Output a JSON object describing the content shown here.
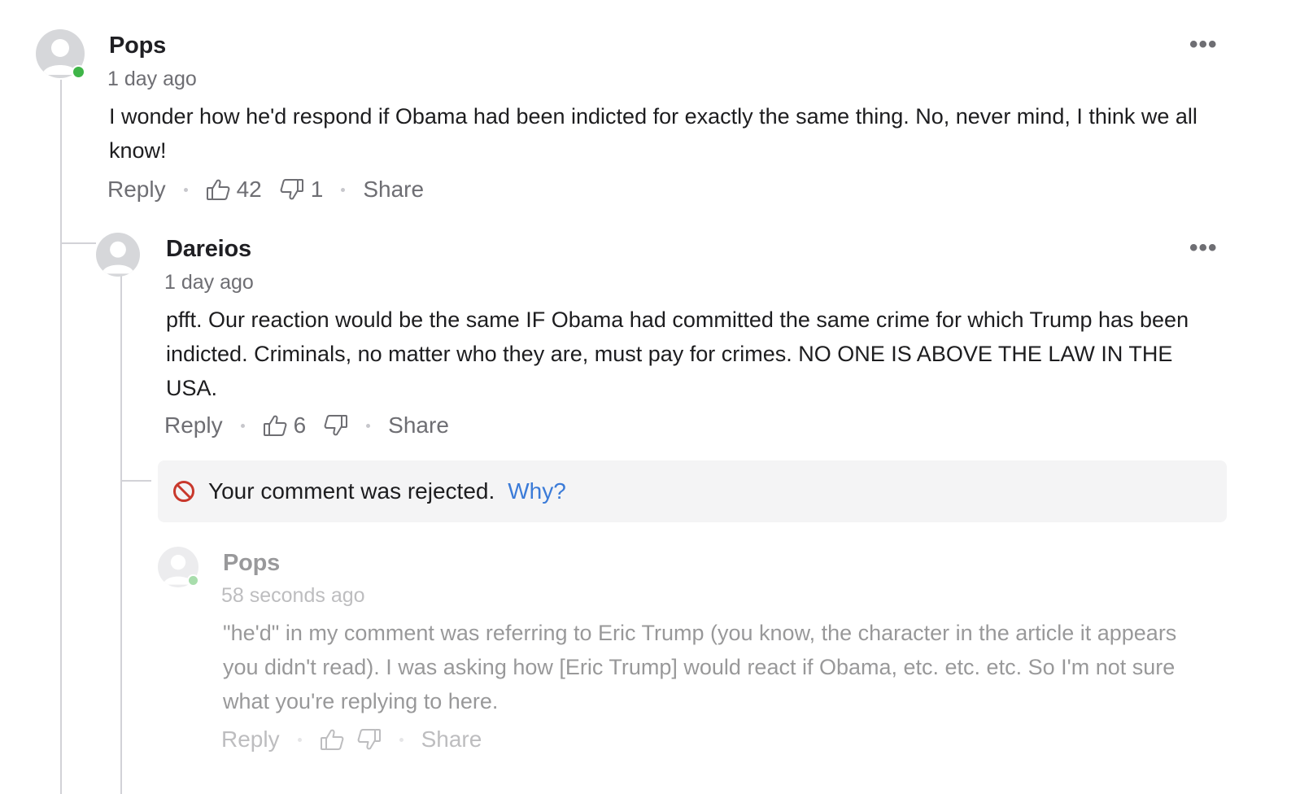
{
  "comments": [
    {
      "author": "Pops",
      "time": "1 day ago",
      "text": "I wonder how he'd respond if Obama had been indicted for exactly the same thing.  No, never mind, I think we all know!",
      "reply_label": "Reply",
      "likes": "42",
      "dislikes": "1",
      "share_label": "Share",
      "online": true
    },
    {
      "author": "Dareios",
      "time": "1 day ago",
      "text": "pfft.  Our reaction would be the same IF Obama had committed the same crime for which Trump has been indicted.   Criminals, no matter who they are, must pay for crimes.  NO ONE IS ABOVE THE LAW IN THE USA.",
      "reply_label": "Reply",
      "likes": "6",
      "dislikes": "",
      "share_label": "Share",
      "online": false
    },
    {
      "author": "Pops",
      "time": "58 seconds ago",
      "text": "\"he'd\" in my comment was referring to Eric Trump (you know, the character in the article it appears you didn't read).  I was asking how [Eric Trump] would react if Obama, etc. etc. etc.  So I'm not sure what you're replying to here.",
      "reply_label": "Reply",
      "likes": "",
      "dislikes": "",
      "share_label": "Share",
      "online": true,
      "status": "rejected"
    }
  ],
  "rejection": {
    "message": "Your comment was rejected.",
    "why_label": "Why?"
  },
  "more_menu_label": "•••",
  "icons": {
    "avatar": "user-avatar-icon",
    "like": "thumbs-up-icon",
    "dislike": "thumbs-down-icon",
    "more": "more-options-icon",
    "blocked": "blocked-icon"
  },
  "colors": {
    "online": "#3fb548",
    "link": "#3b7bd8",
    "rejected_icon": "#c8382c",
    "muted": "#6e6e73",
    "thread_line": "#d2d2d7"
  }
}
